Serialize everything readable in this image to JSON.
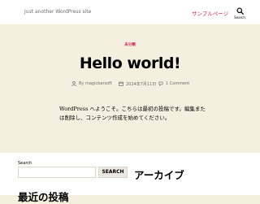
{
  "header": {
    "tagline": "Just another WordPress site",
    "nav_link": "サンプルページ",
    "search_toggle_label": "Search"
  },
  "post": {
    "category": "未分類",
    "title": "Hello world!",
    "author": "By magicbarsoft",
    "date": "2024年7月11日",
    "comments": "1 Comment",
    "content": "WordPress へようこそ。こちらは最初の投稿です。編集または削除し、コンテンツ作成を始めてください。"
  },
  "widgets": {
    "search_label": "Search",
    "search_value": "",
    "search_button": "SEARCH",
    "archive_heading": "アーカイブ",
    "recent_heading": "最近の投稿"
  },
  "colors": {
    "accent": "#cd2653",
    "hero_background": "#f5efe0",
    "header_background": "#ffffff",
    "meta_text": "#6d6d6d"
  },
  "icons": {
    "search": "search-icon",
    "author": "user-icon",
    "date": "calendar-icon",
    "comments": "comment-icon"
  }
}
